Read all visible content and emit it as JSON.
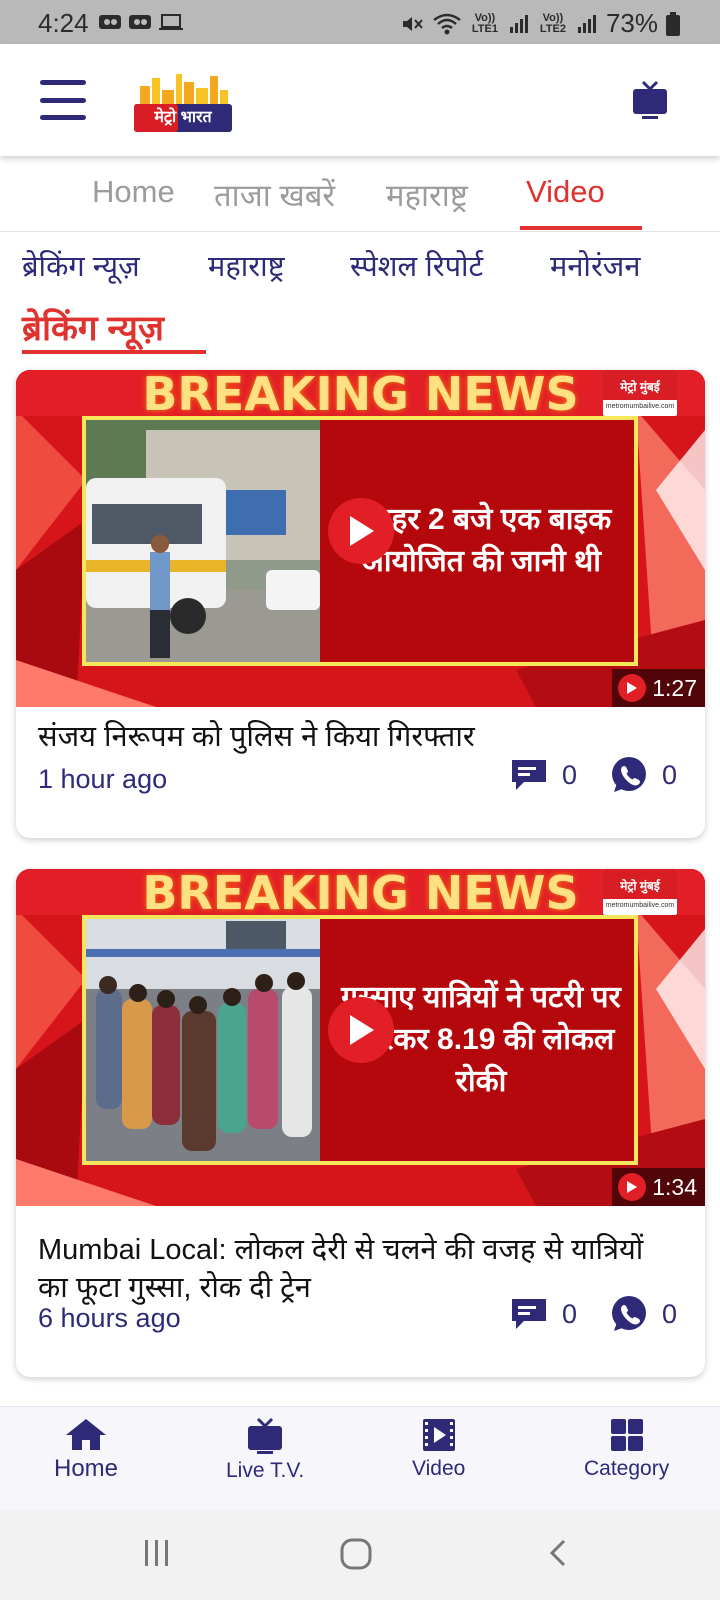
{
  "status_bar": {
    "time": "4:24",
    "battery": "73%",
    "sim1": "Vo)) LTE1",
    "sim2": "Vo)) LTE2"
  },
  "header": {
    "logo_text": "मेट्रो भारत",
    "menu_icon": "hamburger-icon",
    "tv_icon": "tv-icon"
  },
  "tabs": [
    {
      "label": "Home"
    },
    {
      "label": "ताजा खबरें"
    },
    {
      "label": "महाराष्ट्र"
    },
    {
      "label": "Video"
    }
  ],
  "active_tab": "Video",
  "sub_categories": [
    {
      "label": "ब्रेकिंग न्यूज़"
    },
    {
      "label": "महाराष्ट्र"
    },
    {
      "label": "स्पेशल रिपोर्ट"
    },
    {
      "label": "मनोरंजन"
    }
  ],
  "section_title": "ब्रेकिंग न्यूज़",
  "videos": [
    {
      "banner": "BREAKING NEWS",
      "channel": "मेट्रो मुंबई",
      "channel_url": "metromumbailive.com",
      "overlay_text": "दोपहर 2 बजे एक बाइक आयोजित की जानी थी",
      "duration": "1:27",
      "title": "संजय निरूपम को पुलिस ने किया गिरफ्तार",
      "time_ago": "1 hour ago",
      "comments": "0",
      "shares": "0"
    },
    {
      "banner": "BREAKING NEWS",
      "channel": "मेट्रो मुंबई",
      "channel_url": "metromumbailive.com",
      "overlay_text": "गुस्साए यात्रियों ने पटरी पर उतरकर 8.19 की लोकल रोकी",
      "duration": "1:34",
      "title": "Mumbai Local: लोकल देरी से चलने की वजह से यात्रियों का फूटा गुस्सा, रोक दी ट्रेन",
      "time_ago": "6 hours ago",
      "comments": "0",
      "shares": "0"
    }
  ],
  "bottom_nav": [
    {
      "label": "Home",
      "icon": "home-icon"
    },
    {
      "label": "Live T.V.",
      "icon": "tv-icon"
    },
    {
      "label": "Video",
      "icon": "video-icon"
    },
    {
      "label": "Category",
      "icon": "grid-icon"
    }
  ],
  "colors": {
    "primary": "#2e2a78",
    "accent": "#e0332f"
  }
}
